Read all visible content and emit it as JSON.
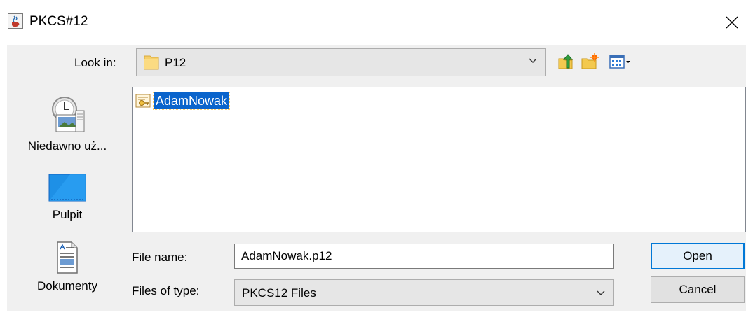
{
  "window": {
    "title": "PKCS#12",
    "app_icon": "java-cup-icon",
    "close_icon": "close-icon"
  },
  "look_in": {
    "label": "Look in:",
    "value": "P12",
    "folder_icon": "folder-icon"
  },
  "toolbar": {
    "up_icon": "up-one-level-icon",
    "new_folder_icon": "new-folder-icon",
    "view_icon": "view-menu-icon"
  },
  "places": [
    {
      "label": "Niedawno uż...",
      "icon": "recent-items-icon"
    },
    {
      "label": "Pulpit",
      "icon": "desktop-icon"
    },
    {
      "label": "Dokumenty",
      "icon": "documents-icon"
    }
  ],
  "files": [
    {
      "name": "AdamNowak",
      "icon": "certificate-file-icon",
      "selected": true
    }
  ],
  "file_name": {
    "label": "File name:",
    "value": "AdamNowak.p12"
  },
  "file_type": {
    "label": "Files of type:",
    "value": "PKCS12 Files"
  },
  "buttons": {
    "open": "Open",
    "cancel": "Cancel"
  },
  "colors": {
    "selection": "#0a64cc",
    "dialog_bg": "#f0f0f0",
    "default_button_border": "#0078d7"
  }
}
